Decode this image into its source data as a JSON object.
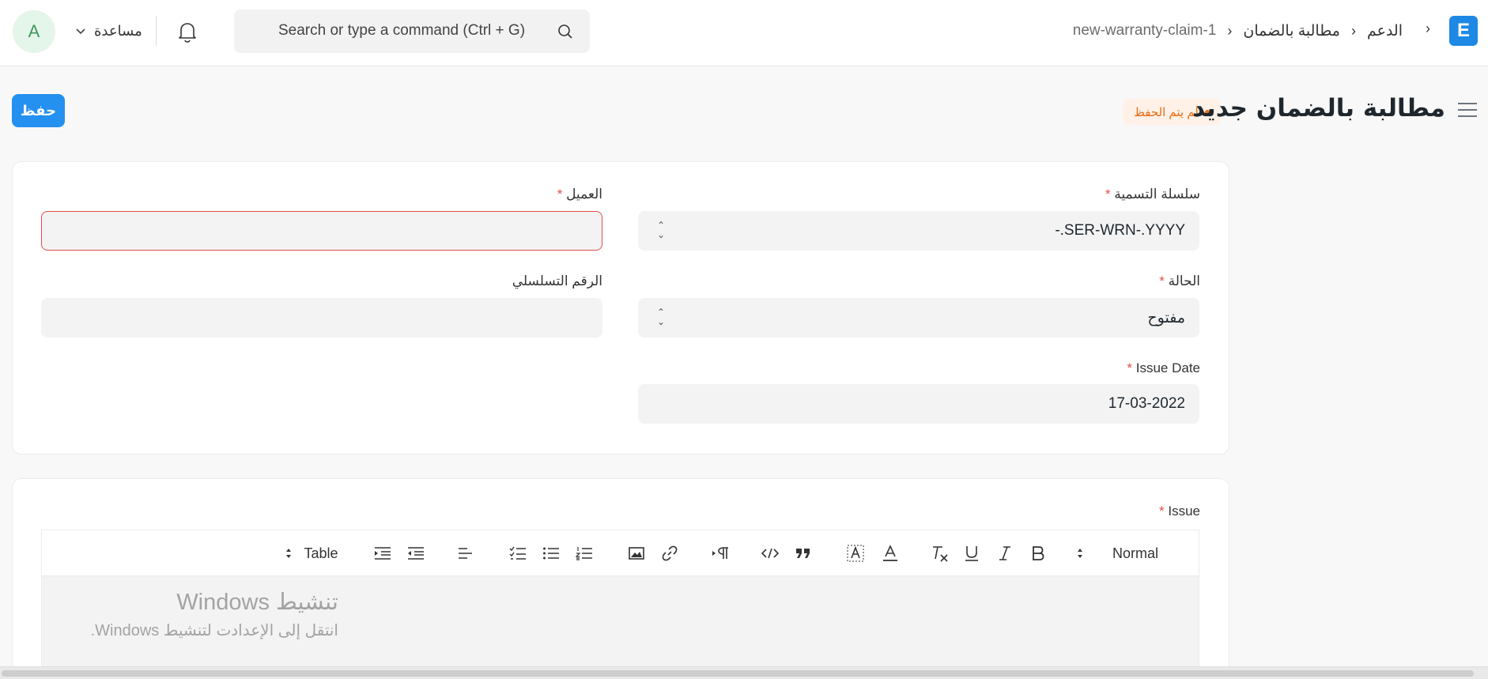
{
  "navbar": {
    "avatar_initial": "A",
    "help_label": "مساعدة",
    "search_placeholder": "Search or type a command (Ctrl + G)",
    "breadcrumbs": [
      "الدعم",
      "مطالبة بالضمان",
      "new-warranty-claim-1"
    ],
    "logo_letter": "E"
  },
  "page": {
    "title": "مطالبة بالضمان جديد",
    "status_indicator": "لم يتم الحفظ",
    "save_label": "حفظ"
  },
  "form": {
    "naming_series": {
      "label": "سلسلة التسمية",
      "value": "-.SER-WRN-.YYYY",
      "required": "*"
    },
    "customer": {
      "label": "العميل",
      "value": "",
      "required": "*"
    },
    "status": {
      "label": "الحالة",
      "value": "مفتوح",
      "required": "*"
    },
    "serial_no": {
      "label": "الرقم التسلسلي",
      "value": ""
    },
    "issue_date": {
      "label": "Issue Date",
      "value": "17-03-2022",
      "required": "*"
    },
    "issue": {
      "label": "Issue",
      "required": "*"
    }
  },
  "editor_toolbar": {
    "table_label": "Table",
    "format_label": "Normal",
    "icons": [
      "table-icon",
      "indent-icon",
      "outdent-icon",
      "align-icon",
      "check-list-icon",
      "bullet-list-icon",
      "ordered-list-icon",
      "image-icon",
      "link-icon",
      "paragraph-direction-icon",
      "code-icon",
      "blockquote-icon",
      "background-color-icon",
      "font-color-icon",
      "clear-format-icon",
      "underline-icon",
      "italic-icon",
      "bold-icon",
      "format-select-icon"
    ]
  },
  "watermark": {
    "line1": "تنشيط Windows",
    "line2": "انتقل إلى الإعدادت لتنشيط Windows."
  },
  "colors": {
    "primary": "#2490ef",
    "warning": "#e86c13",
    "error": "#e24c4c",
    "avatar_bg": "#e4f5e9"
  }
}
